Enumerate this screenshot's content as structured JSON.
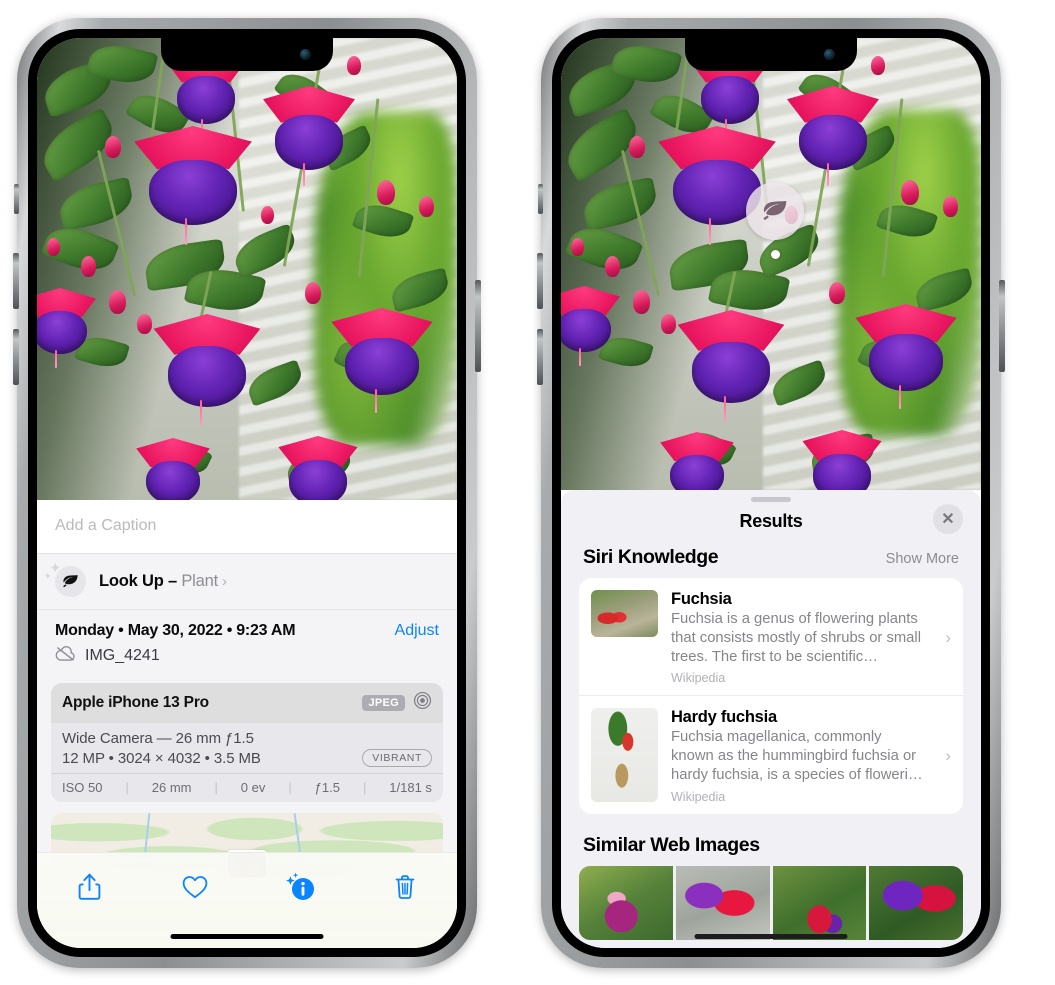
{
  "left_phone": {
    "caption_placeholder": "Add a Caption",
    "lookup": {
      "label": "Look Up –",
      "subject": "Plant",
      "chevron": "›",
      "icon": "leaf-icon"
    },
    "metadata": {
      "date": "Monday • May 30, 2022 • 9:23 AM",
      "adjust_label": "Adjust",
      "filename": "IMG_4241",
      "cloud_icon": "icloud-slash-icon"
    },
    "camera": {
      "model": "Apple iPhone 13 Pro",
      "format_badge": "JPEG",
      "aperture_icon": "aperture-icon",
      "lens_line": "Wide Camera — 26 mm ƒ1.5",
      "specs_line": "12 MP • 3024 × 4032 • 3.5 MB",
      "style_badge": "VIBRANT",
      "exif": [
        "ISO 50",
        "26 mm",
        "0 ev",
        "ƒ1.5",
        "1/181 s"
      ]
    },
    "toolbar": [
      {
        "name": "share-button",
        "icon": "share-icon"
      },
      {
        "name": "favorite-button",
        "icon": "heart-icon"
      },
      {
        "name": "info-button",
        "icon": "info-sparkle-icon"
      },
      {
        "name": "delete-button",
        "icon": "trash-icon"
      }
    ]
  },
  "right_phone": {
    "badge": {
      "icon": "leaf-icon"
    },
    "sheet": {
      "title": "Results",
      "close_label": "✕"
    },
    "siri_knowledge": {
      "section_title": "Siri Knowledge",
      "show_more": "Show More",
      "items": [
        {
          "title": "Fuchsia",
          "description": "Fuchsia is a genus of flowering plants that consists mostly of shrubs or small trees. The first to be scientific…",
          "source": "Wikipedia",
          "chevron": "›"
        },
        {
          "title": "Hardy fuchsia",
          "description": "Fuchsia magellanica, commonly known as the hummingbird fuchsia or hardy fuchsia, is a species of floweri…",
          "source": "Wikipedia",
          "chevron": "›"
        }
      ]
    },
    "similar_web_images": {
      "section_title": "Similar Web Images",
      "count": 4
    }
  },
  "colors": {
    "accent_blue": "#0a84ff",
    "sheet_bg": "#f1f1f5",
    "card_bg": "#ffffff",
    "secondary_text": "#85858b"
  }
}
